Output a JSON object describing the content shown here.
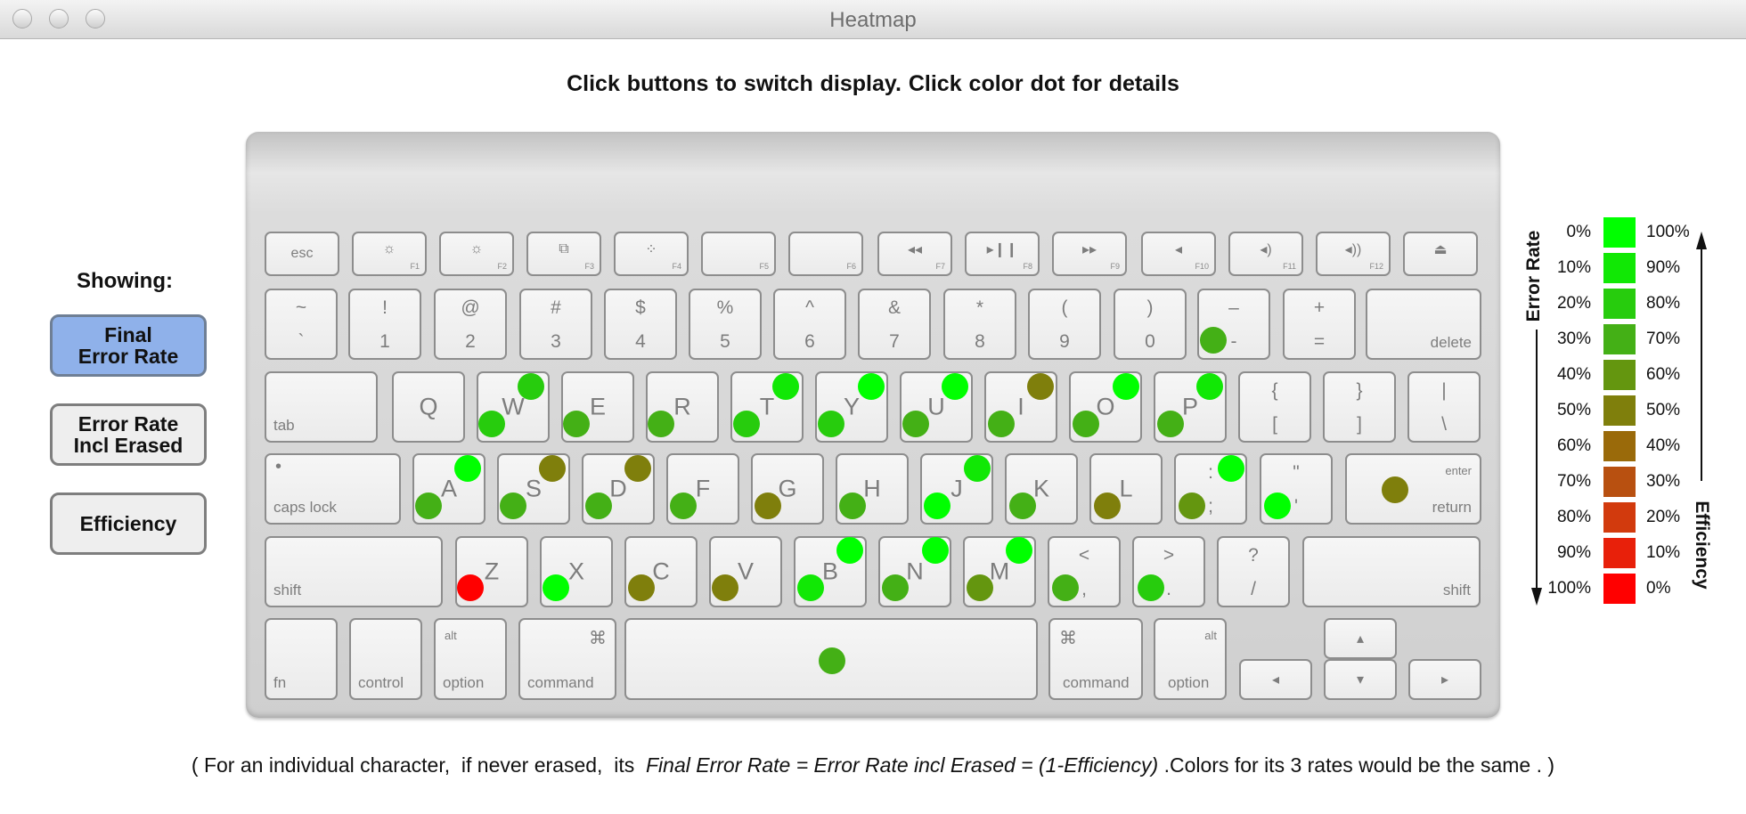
{
  "window": {
    "title": "Heatmap"
  },
  "instructions": "Click buttons to switch display.    Click color dot for details",
  "panel": {
    "showing_label": "Showing:",
    "buttons": [
      {
        "label": "Final\nError Rate",
        "active": true
      },
      {
        "label": "Error Rate\nIncl Erased",
        "active": false
      },
      {
        "label": "Efficiency",
        "active": false
      }
    ]
  },
  "keyboard": {
    "fn_row": [
      {
        "label": "esc"
      },
      {
        "icon": "brightness-down-icon",
        "glyph": "☼",
        "sub": "F1"
      },
      {
        "icon": "brightness-up-icon",
        "glyph": "☼",
        "sub": "F2"
      },
      {
        "icon": "mission-control-icon",
        "glyph": "⧉",
        "sub": "F3"
      },
      {
        "icon": "launchpad-icon",
        "glyph": "⁘",
        "sub": "F4"
      },
      {
        "icon": "",
        "glyph": "",
        "sub": "F5"
      },
      {
        "icon": "",
        "glyph": "",
        "sub": "F6"
      },
      {
        "icon": "rewind-icon",
        "glyph": "◂◂",
        "sub": "F7"
      },
      {
        "icon": "play-pause-icon",
        "glyph": "▸❙❙",
        "sub": "F8"
      },
      {
        "icon": "fast-forward-icon",
        "glyph": "▸▸",
        "sub": "F9"
      },
      {
        "icon": "mute-icon",
        "glyph": "◂",
        "sub": "F10"
      },
      {
        "icon": "volume-down-icon",
        "glyph": "◂)",
        "sub": "F11"
      },
      {
        "icon": "volume-up-icon",
        "glyph": "◂))",
        "sub": "F12"
      },
      {
        "icon": "eject-icon",
        "glyph": "⏏",
        "sub": ""
      }
    ],
    "number_row": [
      {
        "top": "~",
        "bottom": "`"
      },
      {
        "top": "!",
        "bottom": "1"
      },
      {
        "top": "@",
        "bottom": "2"
      },
      {
        "top": "#",
        "bottom": "3"
      },
      {
        "top": "$",
        "bottom": "4"
      },
      {
        "top": "%",
        "bottom": "5"
      },
      {
        "top": "^",
        "bottom": "6"
      },
      {
        "top": "&",
        "bottom": "7"
      },
      {
        "top": "*",
        "bottom": "8"
      },
      {
        "top": "(",
        "bottom": "9"
      },
      {
        "top": ")",
        "bottom": "0"
      },
      {
        "top": "–",
        "bottom": "-"
      },
      {
        "top": "+",
        "bottom": "="
      },
      {
        "label": "delete"
      }
    ],
    "qwerty_row": [
      {
        "label": "tab"
      },
      {
        "glyph": "Q"
      },
      {
        "glyph": "W"
      },
      {
        "glyph": "E"
      },
      {
        "glyph": "R"
      },
      {
        "glyph": "T"
      },
      {
        "glyph": "Y"
      },
      {
        "glyph": "U"
      },
      {
        "glyph": "I"
      },
      {
        "glyph": "O"
      },
      {
        "glyph": "P"
      },
      {
        "top": "{",
        "bottom": "["
      },
      {
        "top": "}",
        "bottom": "]"
      },
      {
        "top": "|",
        "bottom": "\\"
      }
    ],
    "home_row": [
      {
        "label": "caps lock",
        "mark": "•"
      },
      {
        "glyph": "A"
      },
      {
        "glyph": "S"
      },
      {
        "glyph": "D"
      },
      {
        "glyph": "F"
      },
      {
        "glyph": "G"
      },
      {
        "glyph": "H"
      },
      {
        "glyph": "J"
      },
      {
        "glyph": "K"
      },
      {
        "glyph": "L"
      },
      {
        "top": ":",
        "bottom": ";"
      },
      {
        "top": "\"",
        "bottom": "'"
      },
      {
        "label": "return",
        "sub": "enter"
      }
    ],
    "shift_row": [
      {
        "label": "shift"
      },
      {
        "glyph": "Z"
      },
      {
        "glyph": "X"
      },
      {
        "glyph": "C"
      },
      {
        "glyph": "V"
      },
      {
        "glyph": "B"
      },
      {
        "glyph": "N"
      },
      {
        "glyph": "M"
      },
      {
        "top": "<",
        "bottom": ","
      },
      {
        "top": ">",
        "bottom": "."
      },
      {
        "top": "?",
        "bottom": "/"
      },
      {
        "label": "shift"
      }
    ],
    "bottom_row": [
      {
        "label": "fn"
      },
      {
        "label": "control"
      },
      {
        "label": "option",
        "sub": "alt"
      },
      {
        "label": "command",
        "sub": "⌘"
      },
      {
        "label": ""
      },
      {
        "label": "command",
        "sub": "⌘"
      },
      {
        "label": "option",
        "sub": "alt"
      },
      {
        "icon": "arrow-left-icon",
        "glyph": "◂"
      },
      {
        "icon": "arrow-up-icon",
        "glyph": "▴"
      },
      {
        "icon": "arrow-down-icon",
        "glyph": "▾"
      },
      {
        "icon": "arrow-right-icon",
        "glyph": "▸"
      }
    ]
  },
  "heat_dots": [
    {
      "key": "-",
      "error_rate_pct": 30
    },
    {
      "key": "W",
      "error_rate_pct": 20
    },
    {
      "key": "W-shifted",
      "error_rate_pct": 20
    },
    {
      "key": "E",
      "error_rate_pct": 30
    },
    {
      "key": "R",
      "error_rate_pct": 30
    },
    {
      "key": "T",
      "error_rate_pct": 20
    },
    {
      "key": "T-shifted",
      "error_rate_pct": 10
    },
    {
      "key": "Y",
      "error_rate_pct": 20
    },
    {
      "key": "Y-shifted",
      "error_rate_pct": 0
    },
    {
      "key": "U",
      "error_rate_pct": 30
    },
    {
      "key": "U-shifted",
      "error_rate_pct": 0
    },
    {
      "key": "I",
      "error_rate_pct": 30
    },
    {
      "key": "I-shifted",
      "error_rate_pct": 50
    },
    {
      "key": "O",
      "error_rate_pct": 30
    },
    {
      "key": "O-shifted",
      "error_rate_pct": 0
    },
    {
      "key": "P",
      "error_rate_pct": 30
    },
    {
      "key": "P-shifted",
      "error_rate_pct": 10
    },
    {
      "key": "A",
      "error_rate_pct": 30
    },
    {
      "key": "A-shifted",
      "error_rate_pct": 0
    },
    {
      "key": "S",
      "error_rate_pct": 30
    },
    {
      "key": "S-shifted",
      "error_rate_pct": 50
    },
    {
      "key": "D",
      "error_rate_pct": 30
    },
    {
      "key": "D-shifted",
      "error_rate_pct": 50
    },
    {
      "key": "F",
      "error_rate_pct": 30
    },
    {
      "key": "G",
      "error_rate_pct": 50
    },
    {
      "key": "H",
      "error_rate_pct": 30
    },
    {
      "key": "J",
      "error_rate_pct": 0
    },
    {
      "key": "J-shifted",
      "error_rate_pct": 10
    },
    {
      "key": "K",
      "error_rate_pct": 30
    },
    {
      "key": "L",
      "error_rate_pct": 50
    },
    {
      "key": ";",
      "error_rate_pct": 40
    },
    {
      "key": ":",
      "error_rate_pct": 0
    },
    {
      "key": "'",
      "error_rate_pct": 0
    },
    {
      "key": "return",
      "error_rate_pct": 50
    },
    {
      "key": "Z",
      "error_rate_pct": 100
    },
    {
      "key": "X",
      "error_rate_pct": 0
    },
    {
      "key": "C",
      "error_rate_pct": 50
    },
    {
      "key": "V",
      "error_rate_pct": 50
    },
    {
      "key": "B",
      "error_rate_pct": 10
    },
    {
      "key": "B-shifted",
      "error_rate_pct": 0
    },
    {
      "key": "N",
      "error_rate_pct": 30
    },
    {
      "key": "N-shifted",
      "error_rate_pct": 0
    },
    {
      "key": "M",
      "error_rate_pct": 40
    },
    {
      "key": "M-shifted",
      "error_rate_pct": 0
    },
    {
      "key": ",",
      "error_rate_pct": 30
    },
    {
      "key": ".",
      "error_rate_pct": 20
    },
    {
      "key": "space",
      "error_rate_pct": 30
    }
  ],
  "legend": {
    "error_rate_title": "Error Rate",
    "efficiency_title": "Efficiency",
    "steps": [
      {
        "error_rate": "0%",
        "efficiency": "100%",
        "color": "#00ff00"
      },
      {
        "error_rate": "10%",
        "efficiency": "90%",
        "color": "#11e805"
      },
      {
        "error_rate": "20%",
        "efficiency": "80%",
        "color": "#27cc0d"
      },
      {
        "error_rate": "30%",
        "efficiency": "70%",
        "color": "#44b016"
      },
      {
        "error_rate": "40%",
        "efficiency": "60%",
        "color": "#64960f"
      },
      {
        "error_rate": "50%",
        "efficiency": "50%",
        "color": "#7f7f0c"
      },
      {
        "error_rate": "60%",
        "efficiency": "40%",
        "color": "#9a6a0a"
      },
      {
        "error_rate": "70%",
        "efficiency": "30%",
        "color": "#b85010"
      },
      {
        "error_rate": "80%",
        "efficiency": "20%",
        "color": "#d23a0d"
      },
      {
        "error_rate": "90%",
        "efficiency": "10%",
        "color": "#e8200a"
      },
      {
        "error_rate": "100%",
        "efficiency": "0%",
        "color": "#ff0000"
      }
    ]
  },
  "footnote": {
    "pre": "( For an individual character,  if never erased,  its  ",
    "formula": "Final Error Rate = Error Rate incl Erased = (1-Efficiency)",
    "post": " .Colors for its 3 rates would be the same . )"
  }
}
